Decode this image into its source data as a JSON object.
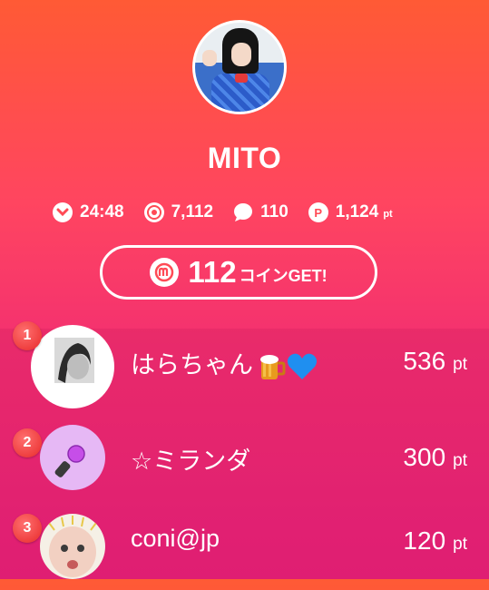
{
  "profile": {
    "name": "MITO",
    "stats": {
      "time": "24:48",
      "views": "7,112",
      "comments": "110",
      "points": "1,124",
      "points_unit": "pt"
    }
  },
  "coin_button": {
    "amount": "112",
    "label": "コインGET!"
  },
  "ranking": [
    {
      "rank": "1",
      "name": "はらちゃん",
      "points": "536",
      "unit": "pt",
      "emojis": [
        "beer-mug-icon",
        "blue-heart-icon"
      ]
    },
    {
      "rank": "2",
      "name": "☆ミランダ",
      "points": "300",
      "unit": "pt"
    },
    {
      "rank": "3",
      "name": "coni@jp",
      "points": "120",
      "unit": "pt"
    }
  ],
  "colors": {
    "gradient_top": "#ff5a35",
    "gradient_bottom": "#e8227a",
    "rank_badge": "#e82a2a"
  }
}
